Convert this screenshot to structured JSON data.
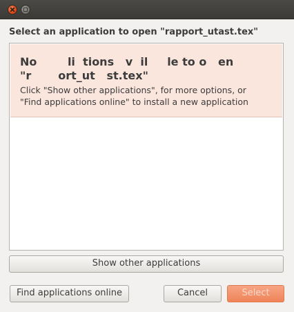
{
  "window": {
    "controls": [
      {
        "icon": "close-icon"
      },
      {
        "icon": "maximize-icon"
      }
    ]
  },
  "dialog": {
    "heading": "Select an application to open \"rapport_utast.tex\"",
    "info_bar": {
      "title_line1": "No        li  tions   v  il     le to o   en",
      "title_line2": "\"r       ort_ut   st.tex\"",
      "message_line1": "Click \"Show other applications\", for more options, or",
      "message_line2": "\"Find applications online\" to install a new application"
    },
    "buttons": {
      "show_other": "Show other applications",
      "find_online": "Find applications online",
      "cancel": "Cancel",
      "select": "Select"
    }
  },
  "colors": {
    "info_bar_background": "#fbe6dd",
    "select_button": "#ef8358",
    "titlebar": "#3c3b37"
  }
}
